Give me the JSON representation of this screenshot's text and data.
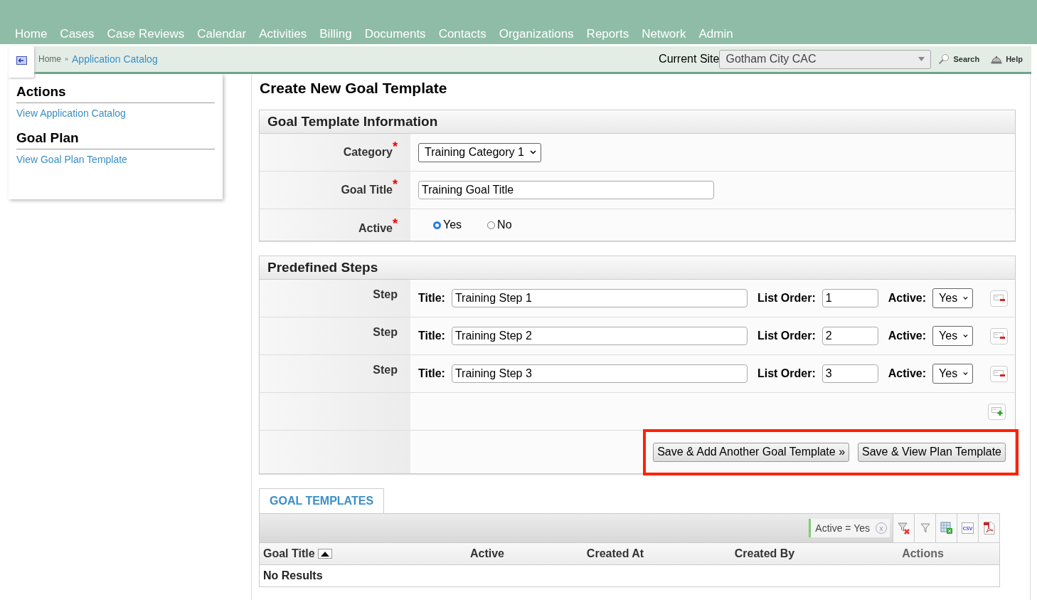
{
  "nav": [
    "Home",
    "Cases",
    "Case Reviews",
    "Calendar",
    "Activities",
    "Billing",
    "Documents",
    "Contacts",
    "Organizations",
    "Reports",
    "Network",
    "Admin"
  ],
  "breadcrumb": {
    "home": "Home",
    "separator": "»",
    "current": "Application Catalog"
  },
  "site": {
    "label": "Current Site",
    "value": "Gotham City CAC"
  },
  "header_links": [
    {
      "kind": "search",
      "label": "Search"
    },
    {
      "kind": "help",
      "label": "Help"
    }
  ],
  "sidebar": [
    {
      "title": "Actions",
      "links": [
        "View Application Catalog"
      ]
    },
    {
      "title": "Goal Plan",
      "links": [
        "View Goal Plan Template"
      ]
    }
  ],
  "page_title": "Create New Goal Template",
  "info": {
    "title": "Goal Template Information",
    "fields": [
      {
        "kind": "select",
        "label": "Category",
        "required_mark": "*",
        "value": "Training Category 1"
      },
      {
        "kind": "text",
        "label": "Goal Title",
        "required_mark": "*",
        "value": "Training Goal Title"
      },
      {
        "kind": "radio",
        "label": "Active",
        "required_mark": "*",
        "options": [
          {
            "label": "Yes",
            "selected": true
          },
          {
            "label": "No",
            "selected": false
          }
        ]
      }
    ]
  },
  "steps": {
    "title": "Predefined Steps",
    "rows": [
      {
        "label": "Step",
        "title_label": "Title:",
        "title": "Training Step 1",
        "order_label": "List Order:",
        "order": "1",
        "active_label": "Active:",
        "active": "Yes"
      },
      {
        "label": "Step",
        "title_label": "Title:",
        "title": "Training Step 2",
        "order_label": "List Order:",
        "order": "2",
        "active_label": "Active:",
        "active": "Yes"
      },
      {
        "label": "Step",
        "title_label": "Title:",
        "title": "Training Step 3",
        "order_label": "List Order:",
        "order": "3",
        "active_label": "Active:",
        "active": "Yes"
      }
    ]
  },
  "actions": {
    "highlighted": true,
    "buttons": [
      "Save & Add Another Goal Template »",
      "Save & View Plan Template"
    ]
  },
  "goal_templates": {
    "tab": {
      "label": "GOAL TEMPLATES",
      "selected": true
    },
    "filter": {
      "label": "Active = Yes",
      "remove": "x"
    },
    "csv_label": "csv",
    "columns": [
      {
        "label": "Goal Title",
        "sorted": true
      },
      {
        "label": "Active",
        "sorted": false
      },
      {
        "label": "Created At",
        "sorted": false
      },
      {
        "label": "Created By",
        "sorted": false
      },
      {
        "label": "Actions",
        "sorted": false
      }
    ],
    "empty": "No Results"
  }
}
